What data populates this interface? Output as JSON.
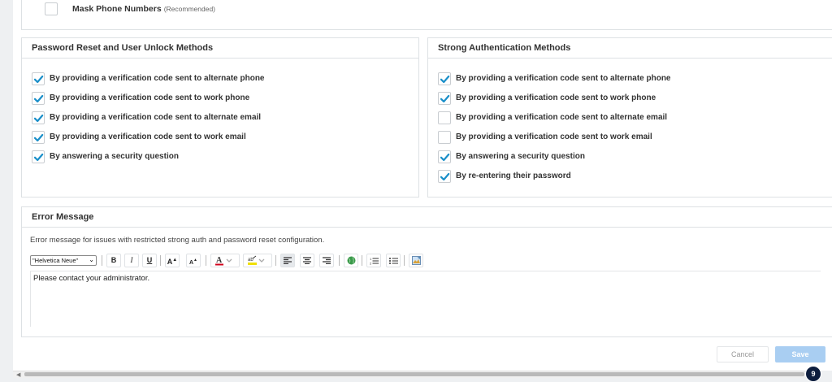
{
  "mask": {
    "label": "Mask Phone Numbers",
    "note": "(Recommended)",
    "checked": false
  },
  "password_reset": {
    "title": "Password Reset and User Unlock Methods",
    "options": [
      {
        "label": "By providing a verification code sent to alternate phone",
        "checked": true
      },
      {
        "label": "By providing a verification code sent to work phone",
        "checked": true
      },
      {
        "label": "By providing a verification code sent to alternate email",
        "checked": true
      },
      {
        "label": "By providing a verification code sent to work email",
        "checked": true
      },
      {
        "label": "By answering a security question",
        "checked": true
      }
    ]
  },
  "strong_auth": {
    "title": "Strong Authentication Methods",
    "options": [
      {
        "label": "By providing a verification code sent to alternate phone",
        "checked": true
      },
      {
        "label": "By providing a verification code sent to work phone",
        "checked": true
      },
      {
        "label": "By providing a verification code sent to alternate email",
        "checked": false
      },
      {
        "label": "By providing a verification code sent to work email",
        "checked": false
      },
      {
        "label": "By answering a security question",
        "checked": true
      },
      {
        "label": "By re-entering their password",
        "checked": true
      }
    ]
  },
  "error_message": {
    "title": "Error Message",
    "description": "Error message for issues with restricted strong auth and password reset configuration.",
    "font_select": "\"Helvetica Neue\"",
    "toolbar": {
      "bold": "B",
      "italic": "I",
      "underline": "U",
      "font_up": "A",
      "font_down": "A"
    },
    "content": "Please contact your administrator."
  },
  "actions": {
    "cancel": "Cancel",
    "save": "Save"
  },
  "notification_count": "9",
  "colors": {
    "check": "#1a8fc9",
    "save_bg": "#a9cef2",
    "badge_bg": "#0d1e3e"
  }
}
